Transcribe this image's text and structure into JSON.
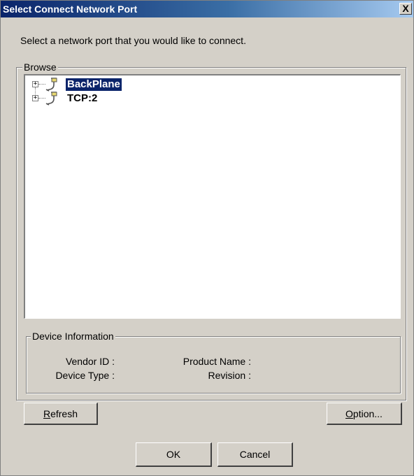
{
  "window": {
    "title": "Select Connect Network Port",
    "close_glyph": "X"
  },
  "instruction": "Select a network port that you would like to connect.",
  "browse": {
    "legend": "Browse",
    "items": [
      {
        "label": "BackPlane",
        "selected": true,
        "icon": "network-port-icon"
      },
      {
        "label": "TCP:2",
        "selected": false,
        "icon": "network-port-icon"
      }
    ]
  },
  "device_info": {
    "legend": "Device Information",
    "vendor_id_label": "Vendor ID :",
    "device_type_label": "Device Type :",
    "product_name_label": "Product Name :",
    "revision_label": "Revision :"
  },
  "buttons": {
    "refresh_mnemonic": "R",
    "refresh_rest": "efresh",
    "option_mnemonic": "O",
    "option_rest": "ption...",
    "ok": "OK",
    "cancel": "Cancel"
  },
  "colors": {
    "selection": "#0a246a",
    "dialog_face": "#d4d0c8"
  }
}
